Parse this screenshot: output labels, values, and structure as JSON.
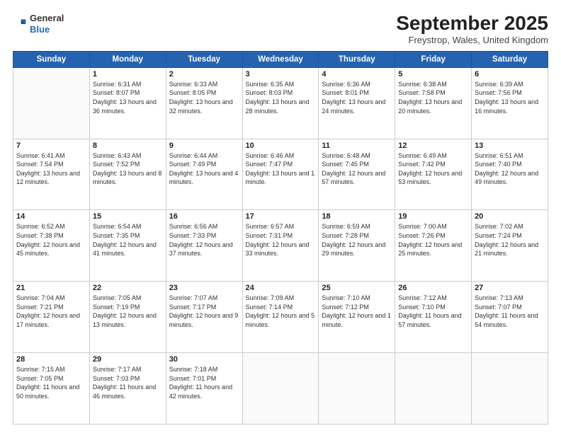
{
  "header": {
    "logo_general": "General",
    "logo_blue": "Blue",
    "month_title": "September 2025",
    "location": "Freystrop, Wales, United Kingdom"
  },
  "days_of_week": [
    "Sunday",
    "Monday",
    "Tuesday",
    "Wednesday",
    "Thursday",
    "Friday",
    "Saturday"
  ],
  "weeks": [
    [
      {
        "day": "",
        "sunrise": "",
        "sunset": "",
        "daylight": ""
      },
      {
        "day": "1",
        "sunrise": "Sunrise: 6:31 AM",
        "sunset": "Sunset: 8:07 PM",
        "daylight": "Daylight: 13 hours and 36 minutes."
      },
      {
        "day": "2",
        "sunrise": "Sunrise: 6:33 AM",
        "sunset": "Sunset: 8:05 PM",
        "daylight": "Daylight: 13 hours and 32 minutes."
      },
      {
        "day": "3",
        "sunrise": "Sunrise: 6:35 AM",
        "sunset": "Sunset: 8:03 PM",
        "daylight": "Daylight: 13 hours and 28 minutes."
      },
      {
        "day": "4",
        "sunrise": "Sunrise: 6:36 AM",
        "sunset": "Sunset: 8:01 PM",
        "daylight": "Daylight: 13 hours and 24 minutes."
      },
      {
        "day": "5",
        "sunrise": "Sunrise: 6:38 AM",
        "sunset": "Sunset: 7:58 PM",
        "daylight": "Daylight: 13 hours and 20 minutes."
      },
      {
        "day": "6",
        "sunrise": "Sunrise: 6:39 AM",
        "sunset": "Sunset: 7:56 PM",
        "daylight": "Daylight: 13 hours and 16 minutes."
      }
    ],
    [
      {
        "day": "7",
        "sunrise": "Sunrise: 6:41 AM",
        "sunset": "Sunset: 7:54 PM",
        "daylight": "Daylight: 13 hours and 12 minutes."
      },
      {
        "day": "8",
        "sunrise": "Sunrise: 6:43 AM",
        "sunset": "Sunset: 7:52 PM",
        "daylight": "Daylight: 13 hours and 8 minutes."
      },
      {
        "day": "9",
        "sunrise": "Sunrise: 6:44 AM",
        "sunset": "Sunset: 7:49 PM",
        "daylight": "Daylight: 13 hours and 4 minutes."
      },
      {
        "day": "10",
        "sunrise": "Sunrise: 6:46 AM",
        "sunset": "Sunset: 7:47 PM",
        "daylight": "Daylight: 13 hours and 1 minute."
      },
      {
        "day": "11",
        "sunrise": "Sunrise: 6:48 AM",
        "sunset": "Sunset: 7:45 PM",
        "daylight": "Daylight: 12 hours and 57 minutes."
      },
      {
        "day": "12",
        "sunrise": "Sunrise: 6:49 AM",
        "sunset": "Sunset: 7:42 PM",
        "daylight": "Daylight: 12 hours and 53 minutes."
      },
      {
        "day": "13",
        "sunrise": "Sunrise: 6:51 AM",
        "sunset": "Sunset: 7:40 PM",
        "daylight": "Daylight: 12 hours and 49 minutes."
      }
    ],
    [
      {
        "day": "14",
        "sunrise": "Sunrise: 6:52 AM",
        "sunset": "Sunset: 7:38 PM",
        "daylight": "Daylight: 12 hours and 45 minutes."
      },
      {
        "day": "15",
        "sunrise": "Sunrise: 6:54 AM",
        "sunset": "Sunset: 7:35 PM",
        "daylight": "Daylight: 12 hours and 41 minutes."
      },
      {
        "day": "16",
        "sunrise": "Sunrise: 6:56 AM",
        "sunset": "Sunset: 7:33 PM",
        "daylight": "Daylight: 12 hours and 37 minutes."
      },
      {
        "day": "17",
        "sunrise": "Sunrise: 6:57 AM",
        "sunset": "Sunset: 7:31 PM",
        "daylight": "Daylight: 12 hours and 33 minutes."
      },
      {
        "day": "18",
        "sunrise": "Sunrise: 6:59 AM",
        "sunset": "Sunset: 7:28 PM",
        "daylight": "Daylight: 12 hours and 29 minutes."
      },
      {
        "day": "19",
        "sunrise": "Sunrise: 7:00 AM",
        "sunset": "Sunset: 7:26 PM",
        "daylight": "Daylight: 12 hours and 25 minutes."
      },
      {
        "day": "20",
        "sunrise": "Sunrise: 7:02 AM",
        "sunset": "Sunset: 7:24 PM",
        "daylight": "Daylight: 12 hours and 21 minutes."
      }
    ],
    [
      {
        "day": "21",
        "sunrise": "Sunrise: 7:04 AM",
        "sunset": "Sunset: 7:21 PM",
        "daylight": "Daylight: 12 hours and 17 minutes."
      },
      {
        "day": "22",
        "sunrise": "Sunrise: 7:05 AM",
        "sunset": "Sunset: 7:19 PM",
        "daylight": "Daylight: 12 hours and 13 minutes."
      },
      {
        "day": "23",
        "sunrise": "Sunrise: 7:07 AM",
        "sunset": "Sunset: 7:17 PM",
        "daylight": "Daylight: 12 hours and 9 minutes."
      },
      {
        "day": "24",
        "sunrise": "Sunrise: 7:09 AM",
        "sunset": "Sunset: 7:14 PM",
        "daylight": "Daylight: 12 hours and 5 minutes."
      },
      {
        "day": "25",
        "sunrise": "Sunrise: 7:10 AM",
        "sunset": "Sunset: 7:12 PM",
        "daylight": "Daylight: 12 hours and 1 minute."
      },
      {
        "day": "26",
        "sunrise": "Sunrise: 7:12 AM",
        "sunset": "Sunset: 7:10 PM",
        "daylight": "Daylight: 11 hours and 57 minutes."
      },
      {
        "day": "27",
        "sunrise": "Sunrise: 7:13 AM",
        "sunset": "Sunset: 7:07 PM",
        "daylight": "Daylight: 11 hours and 54 minutes."
      }
    ],
    [
      {
        "day": "28",
        "sunrise": "Sunrise: 7:15 AM",
        "sunset": "Sunset: 7:05 PM",
        "daylight": "Daylight: 11 hours and 50 minutes."
      },
      {
        "day": "29",
        "sunrise": "Sunrise: 7:17 AM",
        "sunset": "Sunset: 7:03 PM",
        "daylight": "Daylight: 11 hours and 46 minutes."
      },
      {
        "day": "30",
        "sunrise": "Sunrise: 7:18 AM",
        "sunset": "Sunset: 7:01 PM",
        "daylight": "Daylight: 11 hours and 42 minutes."
      },
      {
        "day": "",
        "sunrise": "",
        "sunset": "",
        "daylight": ""
      },
      {
        "day": "",
        "sunrise": "",
        "sunset": "",
        "daylight": ""
      },
      {
        "day": "",
        "sunrise": "",
        "sunset": "",
        "daylight": ""
      },
      {
        "day": "",
        "sunrise": "",
        "sunset": "",
        "daylight": ""
      }
    ]
  ]
}
